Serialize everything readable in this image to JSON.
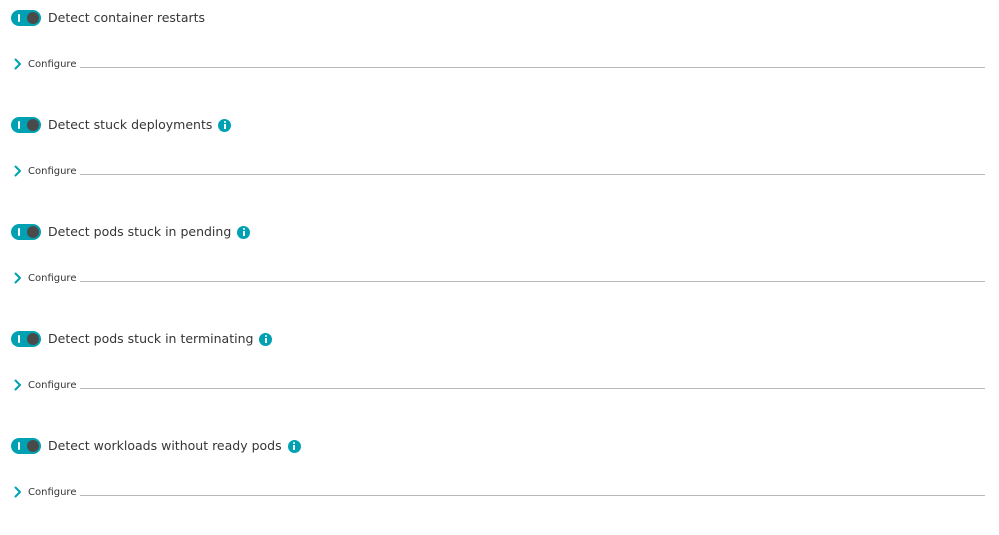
{
  "sections": [
    {
      "toggle_on": true,
      "label": "Detect container restarts",
      "has_info": false,
      "configure_label": "Configure"
    },
    {
      "toggle_on": true,
      "label": "Detect stuck deployments",
      "has_info": true,
      "configure_label": "Configure"
    },
    {
      "toggle_on": true,
      "label": "Detect pods stuck in pending",
      "has_info": true,
      "configure_label": "Configure"
    },
    {
      "toggle_on": true,
      "label": "Detect pods stuck in terminating",
      "has_info": true,
      "configure_label": "Configure"
    },
    {
      "toggle_on": true,
      "label": "Detect workloads without ready pods",
      "has_info": true,
      "configure_label": "Configure"
    }
  ],
  "icons": {
    "toggle": "toggle-switch-icon",
    "info": "info-icon",
    "chevron": "chevron-right-icon"
  },
  "colors": {
    "accent": "#00a1b2",
    "knob": "#4a4a4a",
    "text": "#353535",
    "divider": "#b8b8b8"
  }
}
